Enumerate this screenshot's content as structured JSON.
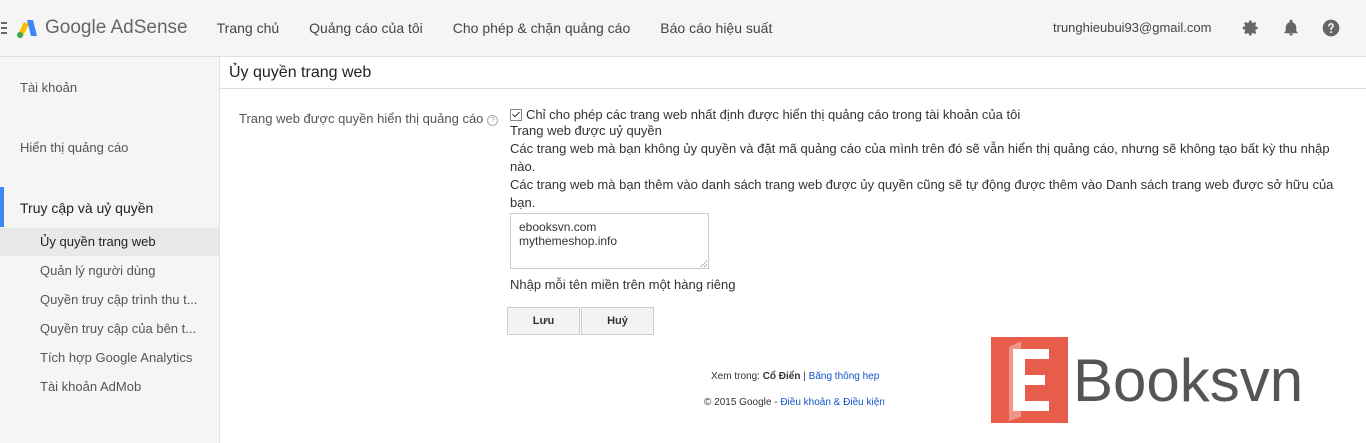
{
  "header": {
    "brand": "Google AdSense",
    "nav": [
      "Trang chủ",
      "Quảng cáo của tôi",
      "Cho phép & chặn quảng cáo",
      "Báo cáo hiệu suất"
    ],
    "email": "trunghieubui93@gmail.com"
  },
  "sidebar": {
    "account": "Tài khoản",
    "ad_display": "Hiển thị quảng cáo",
    "access_section": "Truy cập và uỷ quyền",
    "sub_items": [
      "Ủy quyền trang web",
      "Quản lý người dùng",
      "Quyền truy cập trình thu t...",
      "Quyền truy cập của bên t...",
      "Tích hợp Google Analytics",
      "Tài khoản AdMob"
    ]
  },
  "main": {
    "title": "Ủy quyền trang web",
    "field_label": "Trang web được quyền hiển thị quảng cáo",
    "help_glyph": "?",
    "checkbox_label": "Chỉ cho phép các trang web nhất định được hiển thị quảng cáo trong tài khoản của tôi",
    "authorized_heading": "Trang web được uỷ quyền",
    "note1_line1": "Các trang web mà bạn không ủy quyền và đặt mã quảng cáo của mình trên đó sẽ vẫn hiển thị quảng cáo, nhưng sẽ không tạo bất kỳ thu nhập",
    "note1_line2": "nào.",
    "note2_line1": "Các trang web mà bạn thêm vào danh sách trang web được ủy quyền cũng sẽ tự động được thêm vào Danh sách trang web được sở hữu của",
    "note2_line2": "bạn.",
    "sites": [
      "ebooksvn.com",
      "mythemeshop.info"
    ],
    "hint": "Nhập mỗi tên miền trên một hàng riêng",
    "save_label": "Lưu",
    "cancel_label": "Huỷ"
  },
  "footer": {
    "view_in": "Xem trong:",
    "classic": "Cổ Điển",
    "separator": "|",
    "narrow": "Băng thông hẹp",
    "copyright": "© 2015 Google -",
    "terms": "Điều khoản & Điều kiện"
  },
  "watermark": {
    "text": "Booksvn"
  },
  "colors": {
    "accent": "#4285f4",
    "link": "#1155cc",
    "watermark_red": "#e85c4b"
  }
}
